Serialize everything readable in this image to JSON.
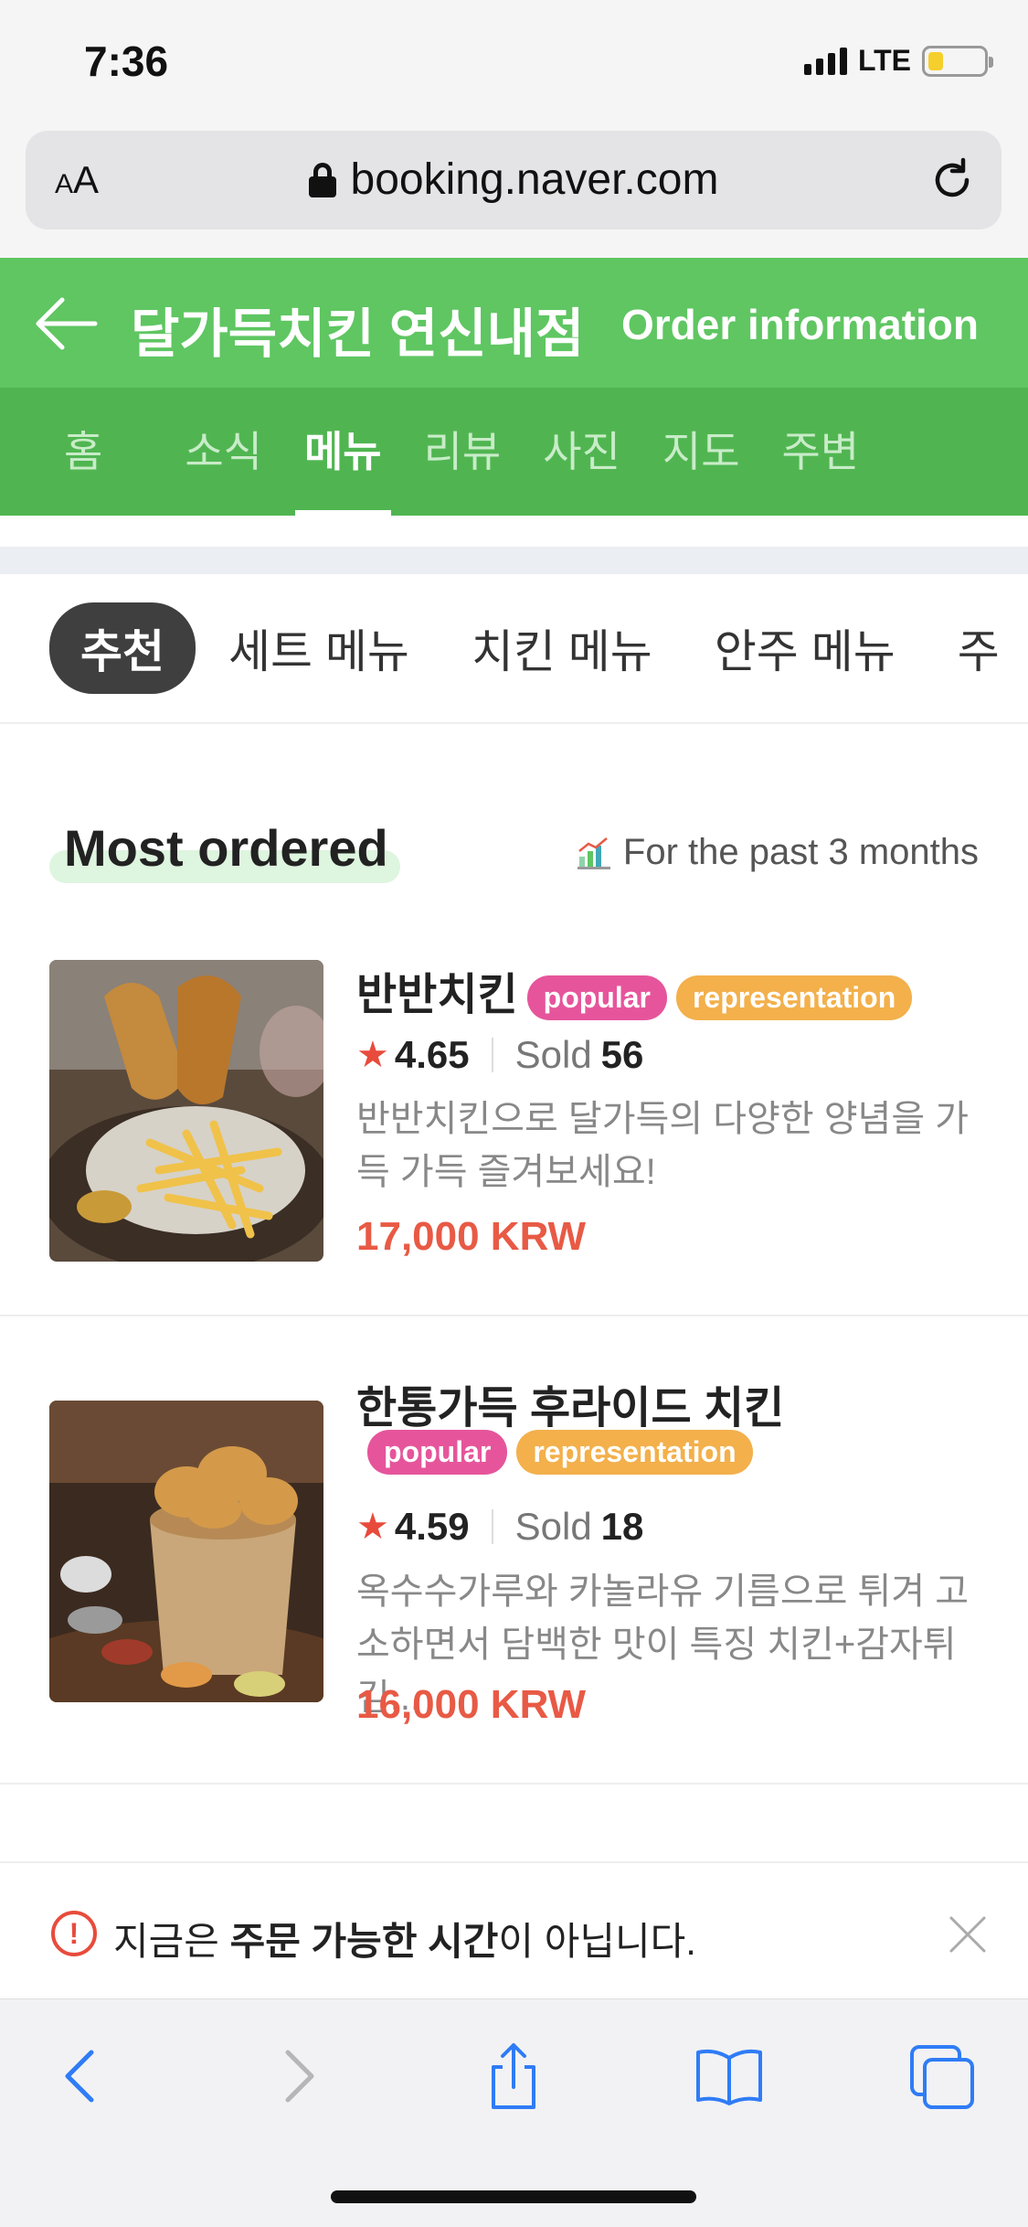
{
  "status_bar": {
    "time": "7:36",
    "network": "LTE",
    "battery_level": 0.28
  },
  "browser": {
    "text_size_label": "AA",
    "url": "booking.naver.com"
  },
  "header": {
    "store_name": "달가득치킨 연신내점",
    "order_info_label": "Order information"
  },
  "tabs": [
    {
      "label": "홈"
    },
    {
      "label": "소식"
    },
    {
      "label": "메뉴",
      "active": true
    },
    {
      "label": "리뷰"
    },
    {
      "label": "사진"
    },
    {
      "label": "지도"
    },
    {
      "label": "주변"
    }
  ],
  "categories": [
    {
      "label": "추천",
      "active": true
    },
    {
      "label": "세트 메뉴"
    },
    {
      "label": "치킨 메뉴"
    },
    {
      "label": "안주 메뉴"
    },
    {
      "label": "주"
    }
  ],
  "section": {
    "title": "Most ordered",
    "period": "For the past 3 months"
  },
  "items": [
    {
      "name": "반반치킨",
      "badges": [
        "popular",
        "representation"
      ],
      "rating": "4.65",
      "sold_label": "Sold",
      "sold": "56",
      "description": "반반치킨으로 달가득의 다양한 양념을 가득 가득 즐겨보세요!",
      "price": "17,000 KRW"
    },
    {
      "name": "한통가득 후라이드 치킨",
      "badges": [
        "popular",
        "representation"
      ],
      "rating": "4.59",
      "sold_label": "Sold",
      "sold": "18",
      "description": "옥수수가루와 카놀라유 기름으로 튀겨 고소하면서 담백한 맛이 특징 치킨+감자튀김...",
      "price": "16,000 KRW"
    }
  ],
  "notice": {
    "prefix": "지금은 ",
    "bold": "주문 가능한 시간",
    "suffix": "이 아닙니다."
  },
  "colors": {
    "brand_green": "#5fc662",
    "tab_green": "#50b551",
    "price_red": "#e85a45",
    "badge_pink": "#e6559b",
    "badge_orange": "#f3b04b",
    "ios_blue": "#2f7cf6"
  }
}
